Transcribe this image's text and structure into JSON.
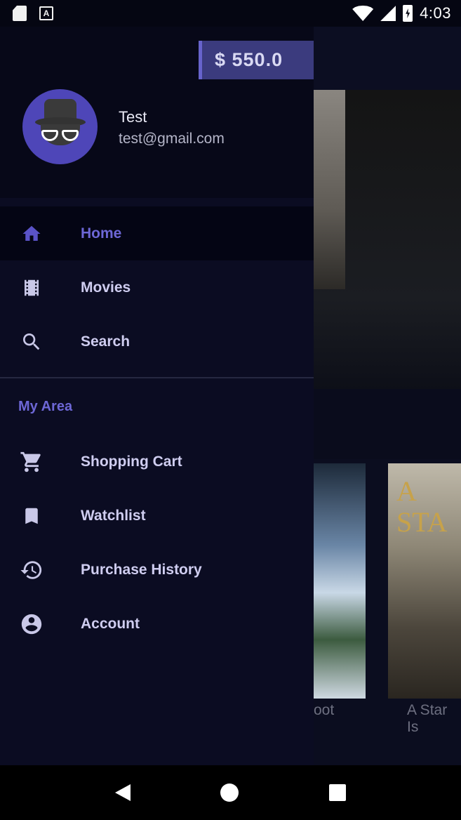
{
  "status_bar": {
    "time": "4:03"
  },
  "balance": "$ 550.0",
  "user": {
    "name": "Test",
    "email": "test@gmail.com"
  },
  "menu": {
    "main": [
      {
        "label": "Home",
        "icon": "home-icon",
        "active": true
      },
      {
        "label": "Movies",
        "icon": "film-icon",
        "active": false
      },
      {
        "label": "Search",
        "icon": "search-icon",
        "active": false
      }
    ],
    "section_title": "My Area",
    "my_area": [
      {
        "label": "Shopping Cart",
        "icon": "cart-icon"
      },
      {
        "label": "Watchlist",
        "icon": "bookmark-icon"
      },
      {
        "label": "Purchase History",
        "icon": "history-icon"
      },
      {
        "label": "Account",
        "icon": "account-circle-icon"
      }
    ]
  },
  "background": {
    "poster_captions": [
      "oot",
      "A Star Is"
    ],
    "poster2_title": "A STA"
  },
  "colors": {
    "accent": "#6d67d6",
    "drawer_bg": "#0b0c22",
    "header_bg": "#070818",
    "balance_bg": "#3b3b7e"
  }
}
